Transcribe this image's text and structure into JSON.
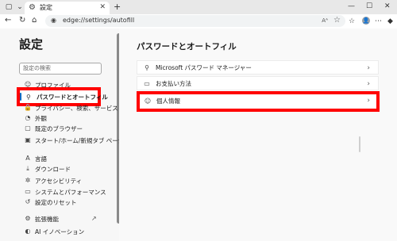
{
  "browser": {
    "tab_title": "設定",
    "new_tab": "+",
    "url": "edge://settings/autofill",
    "window_controls": {
      "minimize": "—",
      "maximize": "☐",
      "close": "✕"
    }
  },
  "sidebar": {
    "title": "設定",
    "search_placeholder": "設定の検索",
    "items": [
      {
        "label": "プロファイル",
        "icon": "user-icon",
        "glyph": "☺"
      },
      {
        "label": "パスワードとオートフィル",
        "icon": "key-icon",
        "glyph": "⚲",
        "active": true
      },
      {
        "label": "プライバシー、検索、サービス",
        "icon": "lock-icon",
        "glyph": "🔒"
      },
      {
        "label": "外観",
        "icon": "appearance-icon",
        "glyph": "◔"
      },
      {
        "label": "既定のブラウザー",
        "icon": "browser-icon",
        "glyph": "▢"
      },
      {
        "label": "スタート/ホーム/新規タブ ページ",
        "icon": "start-page-icon",
        "glyph": "▣"
      },
      {
        "label": "言語",
        "icon": "language-icon",
        "glyph": "A"
      },
      {
        "label": "ダウンロード",
        "icon": "download-icon",
        "glyph": "⤓"
      },
      {
        "label": "アクセシビリティ",
        "icon": "accessibility-icon",
        "glyph": "✲"
      },
      {
        "label": "システムとパフォーマンス",
        "icon": "system-icon",
        "glyph": "▭"
      },
      {
        "label": "設定のリセット",
        "icon": "reset-icon",
        "glyph": "↺"
      },
      {
        "label": "拡張機能",
        "icon": "extensions-icon",
        "glyph": "⚙"
      },
      {
        "label": "AI イノベーション",
        "icon": "ai-icon",
        "glyph": "◐"
      }
    ]
  },
  "main": {
    "title": "パスワードとオートフィル",
    "cards": [
      {
        "label": "Microsoft パスワード マネージャー",
        "icon": "key-icon",
        "glyph": "⚲"
      },
      {
        "label": "お支払い方法",
        "icon": "card-icon",
        "glyph": "▭"
      },
      {
        "label": "個人情報",
        "icon": "personal-info-icon",
        "glyph": "☺"
      }
    ]
  },
  "colors": {
    "highlight": "#ff0000",
    "accent": "#0067c0"
  }
}
